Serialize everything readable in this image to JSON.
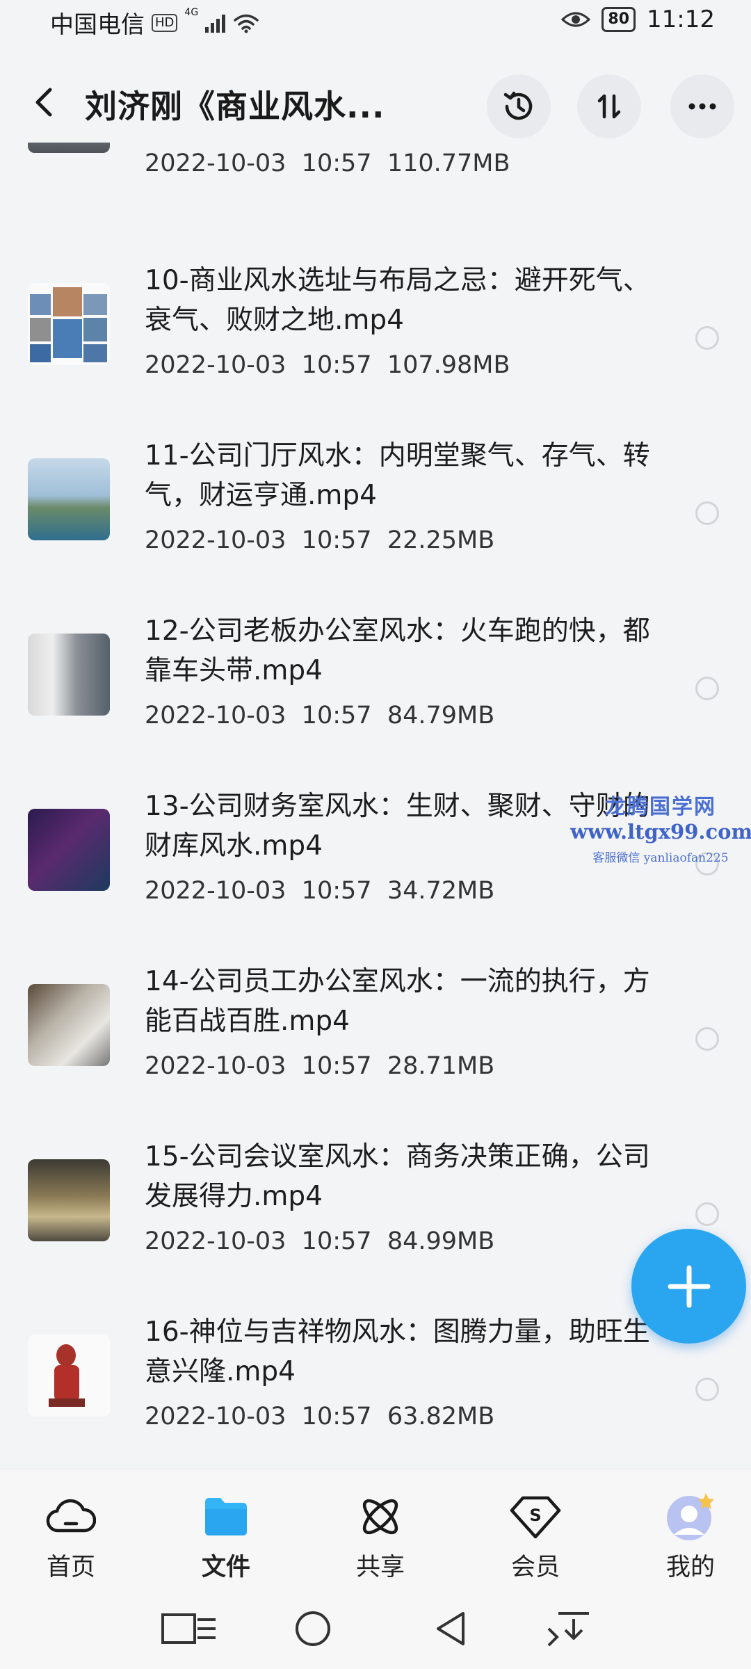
{
  "status_bar": {
    "carrier": "中国电信",
    "hd": "HD",
    "network": "4G",
    "battery": "80",
    "time": "11:12"
  },
  "header": {
    "title": "刘济刚《商业风水...",
    "back_icon": "back-arrow-icon",
    "history_icon": "history-icon",
    "sort_icon": "sort-icon",
    "more_icon": "more-icon"
  },
  "files": [
    {
      "name": "",
      "date": "2022-10-03",
      "time": "10:57",
      "size": "110.77MB"
    },
    {
      "name": "10-商业风水选址与布局之忌：避开死气、衰气、败财之地.mp4",
      "date": "2022-10-03",
      "time": "10:57",
      "size": "107.98MB"
    },
    {
      "name": "11-公司门厅风水：内明堂聚气、存气、转气，财运亨通.mp4",
      "date": "2022-10-03",
      "time": "10:57",
      "size": "22.25MB"
    },
    {
      "name": "12-公司老板办公室风水：火车跑的快，都靠车头带.mp4",
      "date": "2022-10-03",
      "time": "10:57",
      "size": "84.79MB"
    },
    {
      "name": "13-公司财务室风水：生财、聚财、守财的财库风水.mp4",
      "date": "2022-10-03",
      "time": "10:57",
      "size": "34.72MB"
    },
    {
      "name": "14-公司员工办公室风水：一流的执行，方能百战百胜.mp4",
      "date": "2022-10-03",
      "time": "10:57",
      "size": "28.71MB"
    },
    {
      "name": "15-公司会议室风水：商务决策正确，公司发展得力.mp4",
      "date": "2022-10-03",
      "time": "10:57",
      "size": "84.99MB"
    },
    {
      "name": "16-神位与吉祥物风水：图腾力量，助旺生意兴隆.mp4",
      "date": "2022-10-03",
      "time": "10:57",
      "size": "63.82MB"
    }
  ],
  "watermark": {
    "line1": "龙腾国学网",
    "line2": "www.ltgx99.com",
    "line3": "客服微信 yanliaofan225"
  },
  "fab": {
    "icon": "plus-icon"
  },
  "bottom_nav": [
    {
      "label": "首页",
      "icon": "cloud-home-icon",
      "active": false
    },
    {
      "label": "文件",
      "icon": "folder-icon",
      "active": true
    },
    {
      "label": "共享",
      "icon": "share-atom-icon",
      "active": false
    },
    {
      "label": "会员",
      "icon": "vip-diamond-icon",
      "active": false
    },
    {
      "label": "我的",
      "icon": "avatar-icon",
      "active": false
    }
  ],
  "colors": {
    "accent": "#2aa6f0",
    "background": "#f3f4f6",
    "watermark": "#4b6fd1"
  }
}
